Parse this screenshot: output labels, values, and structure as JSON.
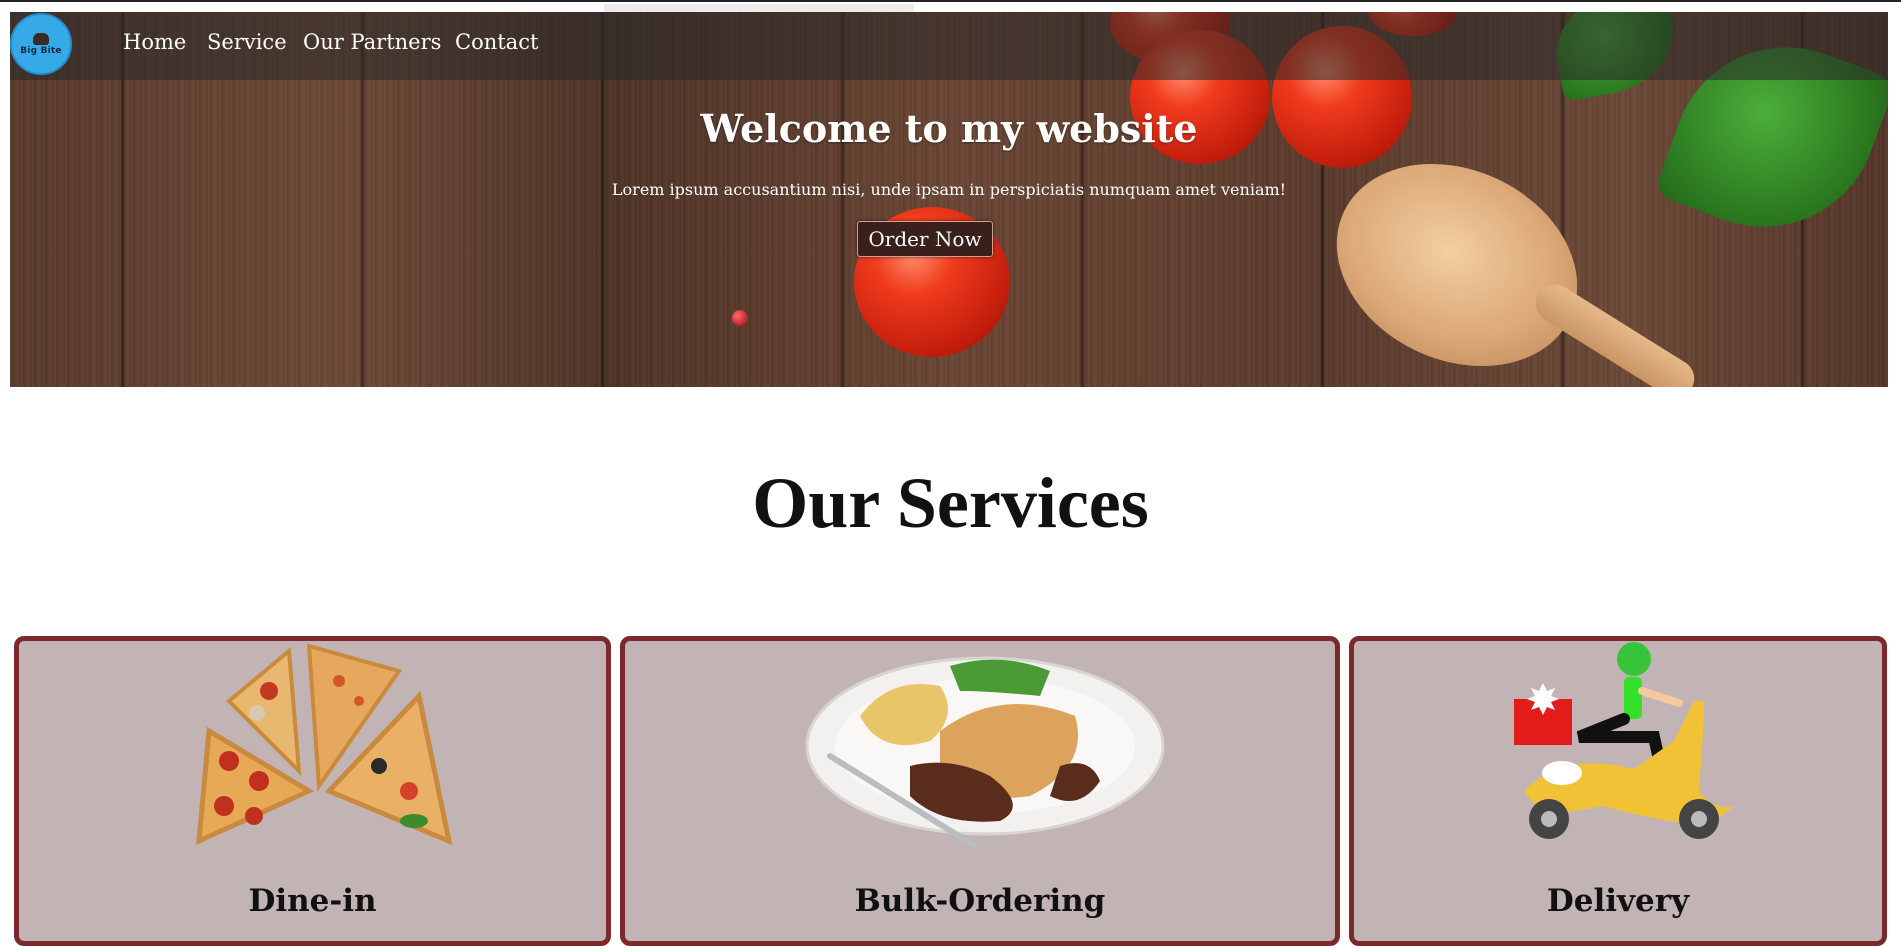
{
  "brand": {
    "logo_text": "Big Bite",
    "logo_color": "#36a9e8"
  },
  "nav": {
    "items": [
      {
        "label": "Home"
      },
      {
        "label": "Service"
      },
      {
        "label": "Our Partners"
      },
      {
        "label": "Contact"
      }
    ]
  },
  "hero": {
    "title": "Welcome to my website",
    "subtitle": "Lorem ipsum accusantium nisi, unde ipsam in perspiciatis numquam amet veniam!",
    "cta_label": "Order Now"
  },
  "services": {
    "title": "Our Services",
    "cards": [
      {
        "name": "Dine-in",
        "icon": "pizza-slices-icon"
      },
      {
        "name": "Bulk-Ordering",
        "icon": "dinner-plate-icon"
      },
      {
        "name": "Delivery",
        "icon": "delivery-scooter-icon"
      }
    ],
    "card_color": "#c2b4b5",
    "card_border_color": "#7a2a2a"
  }
}
